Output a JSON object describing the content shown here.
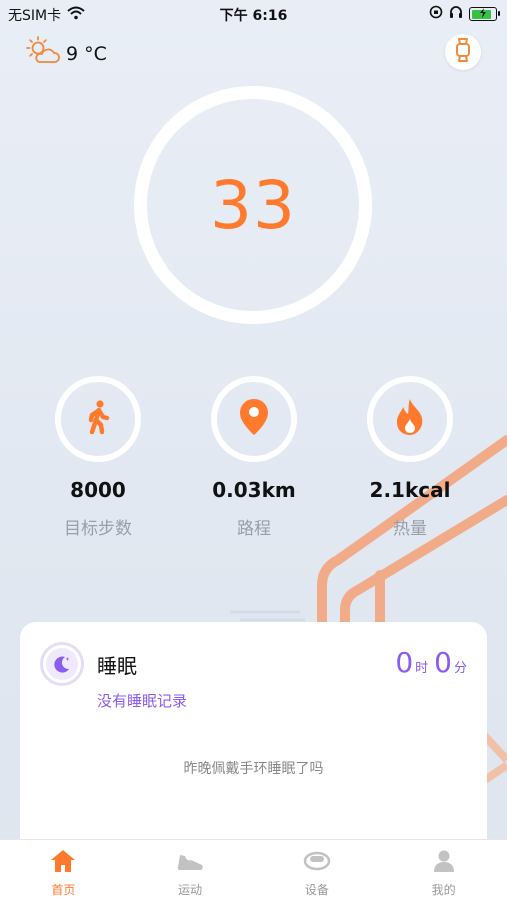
{
  "colors": {
    "accent": "#ff7a2c",
    "sleep": "#8b5cf0",
    "muted": "#9a9ea6",
    "tab_inactive": "#c2c2c2"
  },
  "status_bar": {
    "carrier": "无SIM卡",
    "time": "下午 6:16",
    "icons": [
      "wifi-icon",
      "rotation-lock-icon",
      "headphones-icon",
      "battery-charging-icon"
    ]
  },
  "weather": {
    "icon": "sun-cloud-icon",
    "temperature": "9 °C"
  },
  "header": {
    "device_icon": "watch-icon"
  },
  "steps": {
    "count": "33"
  },
  "stats": [
    {
      "icon": "walking-person-icon",
      "value": "8000",
      "label": "目标步数"
    },
    {
      "icon": "location-pin-icon",
      "value": "0.03km",
      "label": "路程"
    },
    {
      "icon": "flame-icon",
      "value": "2.1kcal",
      "label": "热量"
    }
  ],
  "sleep": {
    "icon": "moon-stars-icon",
    "title": "睡眠",
    "hours": "0",
    "hours_unit": "时",
    "minutes": "0",
    "minutes_unit": "分",
    "no_record": "没有睡眠记录",
    "hint": "昨晚佩戴手环睡眠了吗"
  },
  "tabs": [
    {
      "icon": "home-icon",
      "label": "首页",
      "active": true
    },
    {
      "icon": "sneaker-icon",
      "label": "运动",
      "active": false
    },
    {
      "icon": "band-device-icon",
      "label": "设备",
      "active": false
    },
    {
      "icon": "user-icon",
      "label": "我的",
      "active": false
    }
  ]
}
